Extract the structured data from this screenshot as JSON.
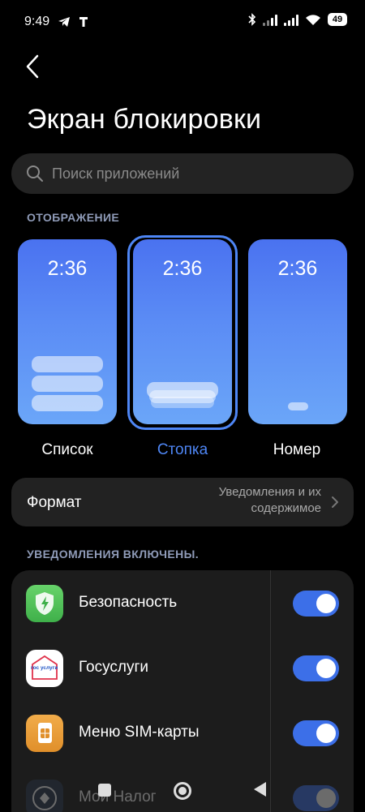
{
  "status_bar": {
    "time": "9:49",
    "battery": "49",
    "icons": [
      "telegram-icon",
      "t-icon",
      "bluetooth-icon",
      "signal-icon",
      "signal-icon",
      "wifi-icon",
      "battery-icon"
    ]
  },
  "header": {
    "back_icon": "chevron-left-icon",
    "title": "Экран блокировки"
  },
  "search": {
    "placeholder": "Поиск приложений",
    "icon": "search-icon"
  },
  "display_section": {
    "label": "ОТОБРАЖЕНИЕ",
    "styles": [
      {
        "time": "2:36",
        "caption": "Список",
        "selected": false
      },
      {
        "time": "2:36",
        "caption": "Стопка",
        "selected": true
      },
      {
        "time": "2:36",
        "caption": "Номер",
        "selected": false
      }
    ],
    "accent_color": "#4e86f5"
  },
  "format": {
    "title": "Формат",
    "value_line1": "Уведомления и их",
    "value_line2": "содержимое"
  },
  "notifications_section": {
    "label": "УВЕДОМЛЕНИЯ ВКЛЮЧЕНЫ.",
    "apps": [
      {
        "name": "Безопасность",
        "icon": "security-app-icon",
        "enabled": true
      },
      {
        "name": "Госуслуги",
        "icon": "gosuslugi-app-icon",
        "icon_text": "гос услуги",
        "enabled": true
      },
      {
        "name": "Меню SIM-карты",
        "icon": "sim-card-app-icon",
        "enabled": true
      },
      {
        "name": "Мой Налог",
        "icon": "tax-app-icon",
        "enabled": true
      }
    ],
    "toggle_color": "#3c6fe8"
  },
  "nav_bar": {
    "buttons": [
      "recent-apps-button",
      "home-button",
      "back-button"
    ]
  }
}
